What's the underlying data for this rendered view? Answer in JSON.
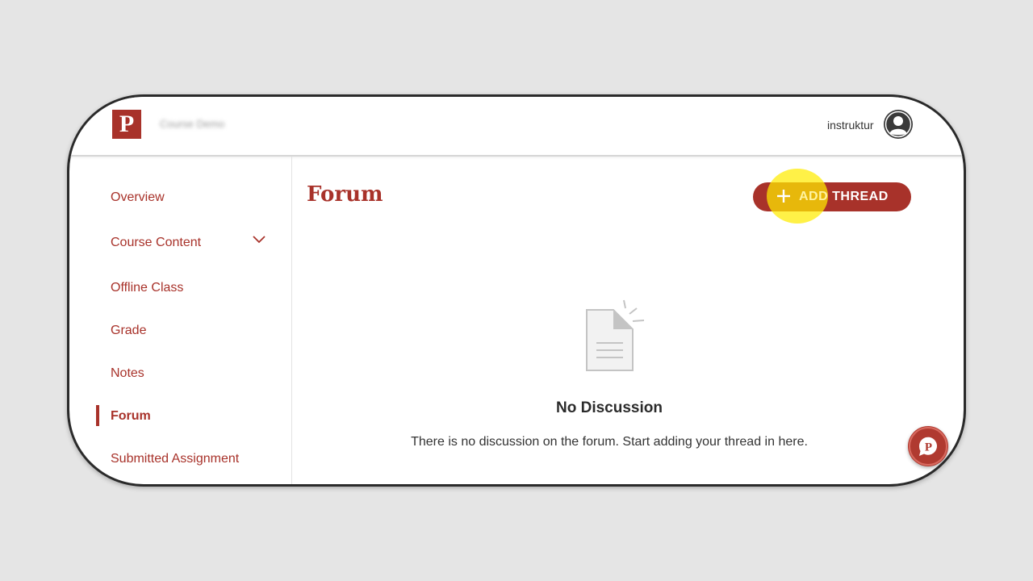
{
  "header": {
    "logo_letter": "P",
    "course_title": "Course Demo",
    "username": "instruktur"
  },
  "sidebar": {
    "items": [
      {
        "label": "Overview"
      },
      {
        "label": "Course Content",
        "has_dropdown": true
      },
      {
        "label": "Offline Class"
      },
      {
        "label": "Grade"
      },
      {
        "label": "Notes"
      },
      {
        "label": "Forum",
        "active": true
      },
      {
        "label": "Submitted Assignment"
      }
    ]
  },
  "main": {
    "title": "Forum",
    "add_button": {
      "icon": "plus-icon",
      "label_part1": "ADD",
      "label_part2": " THREAD"
    },
    "empty_state": {
      "icon": "empty-document-icon",
      "title": "No Discussion",
      "description": "There is no discussion on the forum. Start adding your thread in here."
    }
  },
  "chat": {
    "icon": "chat-bubble-logo-icon",
    "letter": "P"
  },
  "colors": {
    "brand": "#a8322a",
    "highlight": "#ffec00",
    "background": "#e5e5e5"
  }
}
